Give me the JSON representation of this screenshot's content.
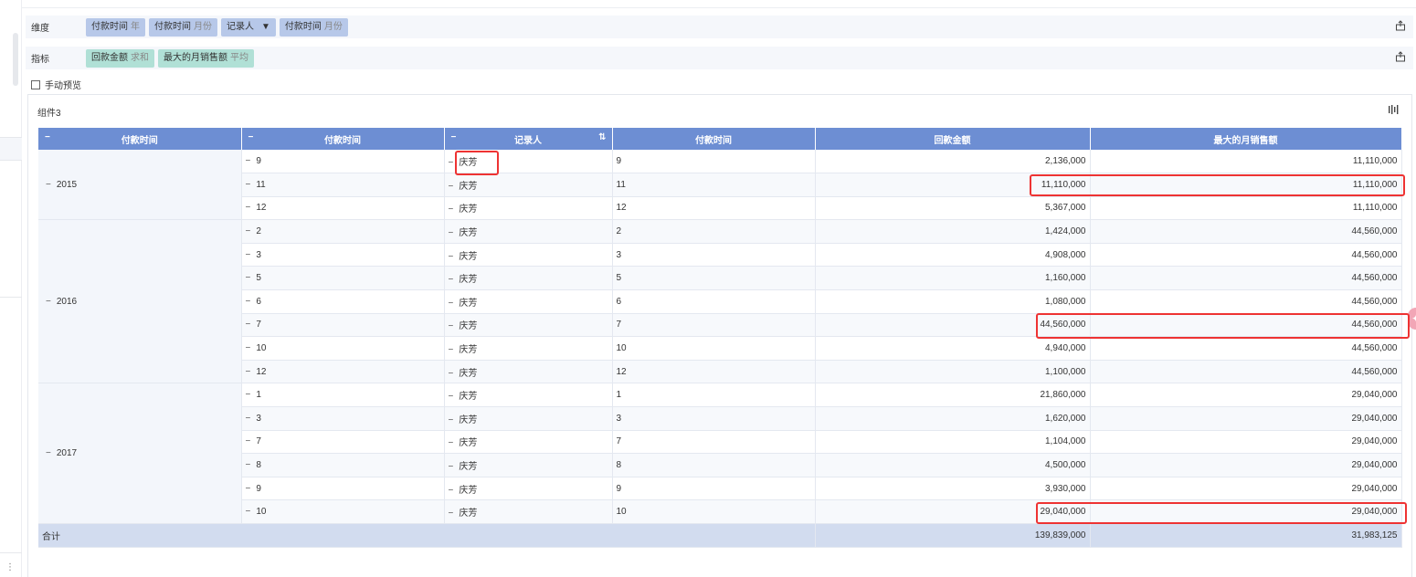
{
  "dimension_row": {
    "label": "维度",
    "fields": [
      {
        "name": "付款时间",
        "sub": "年"
      },
      {
        "name": "付款时间",
        "sub": "月份"
      },
      {
        "name": "记录人",
        "sub": ""
      },
      {
        "name": "付款时间",
        "sub": "月份"
      }
    ]
  },
  "measure_row": {
    "label": "指标",
    "fields": [
      {
        "name": "回款金额",
        "sub": "求和"
      },
      {
        "name": "最大的月销售额",
        "sub": "平均"
      }
    ]
  },
  "manual_preview": {
    "label": "手动预览",
    "checked": false
  },
  "component": {
    "title": "组件3"
  },
  "table": {
    "headers": [
      "付款时间",
      "付款时间",
      "记录人",
      "付款时间",
      "回款金额",
      "最大的月销售额"
    ],
    "groups": [
      {
        "year": "2015",
        "rows": [
          {
            "month": "9",
            "person": "庆芳",
            "month2": "9",
            "amount": "2,136,000",
            "max": "11,110,000"
          },
          {
            "month": "11",
            "person": "庆芳",
            "month2": "11",
            "amount": "11,110,000",
            "max": "11,110,000"
          },
          {
            "month": "12",
            "person": "庆芳",
            "month2": "12",
            "amount": "5,367,000",
            "max": "11,110,000"
          }
        ]
      },
      {
        "year": "2016",
        "rows": [
          {
            "month": "2",
            "person": "庆芳",
            "month2": "2",
            "amount": "1,424,000",
            "max": "44,560,000"
          },
          {
            "month": "3",
            "person": "庆芳",
            "month2": "3",
            "amount": "4,908,000",
            "max": "44,560,000"
          },
          {
            "month": "5",
            "person": "庆芳",
            "month2": "5",
            "amount": "1,160,000",
            "max": "44,560,000"
          },
          {
            "month": "6",
            "person": "庆芳",
            "month2": "6",
            "amount": "1,080,000",
            "max": "44,560,000"
          },
          {
            "month": "7",
            "person": "庆芳",
            "month2": "7",
            "amount": "44,560,000",
            "max": "44,560,000"
          },
          {
            "month": "10",
            "person": "庆芳",
            "month2": "10",
            "amount": "4,940,000",
            "max": "44,560,000"
          },
          {
            "month": "12",
            "person": "庆芳",
            "month2": "12",
            "amount": "1,100,000",
            "max": "44,560,000"
          }
        ]
      },
      {
        "year": "2017",
        "rows": [
          {
            "month": "1",
            "person": "庆芳",
            "month2": "1",
            "amount": "21,860,000",
            "max": "29,040,000"
          },
          {
            "month": "3",
            "person": "庆芳",
            "month2": "3",
            "amount": "1,620,000",
            "max": "29,040,000"
          },
          {
            "month": "7",
            "person": "庆芳",
            "month2": "7",
            "amount": "1,104,000",
            "max": "29,040,000"
          },
          {
            "month": "8",
            "person": "庆芳",
            "month2": "8",
            "amount": "4,500,000",
            "max": "29,040,000"
          },
          {
            "month": "9",
            "person": "庆芳",
            "month2": "9",
            "amount": "3,930,000",
            "max": "29,040,000"
          },
          {
            "month": "10",
            "person": "庆芳",
            "month2": "10",
            "amount": "29,040,000",
            "max": "29,040,000"
          }
        ]
      }
    ],
    "total": {
      "label": "合计",
      "amount": "139,839,000",
      "max": "31,983,125"
    }
  },
  "icons": {
    "field_row_action": "export-icon",
    "component_action": "column-settings-icon",
    "dim_filter": "funnel-icon",
    "header_sort": "sort-icon"
  },
  "colors": {
    "header_bg": "#6d8ed3",
    "dimension_pill": "#b7c8e9",
    "measure_pill": "#b0e0d6",
    "total_row": "#d2dcef",
    "highlight_box": "#e33333"
  }
}
